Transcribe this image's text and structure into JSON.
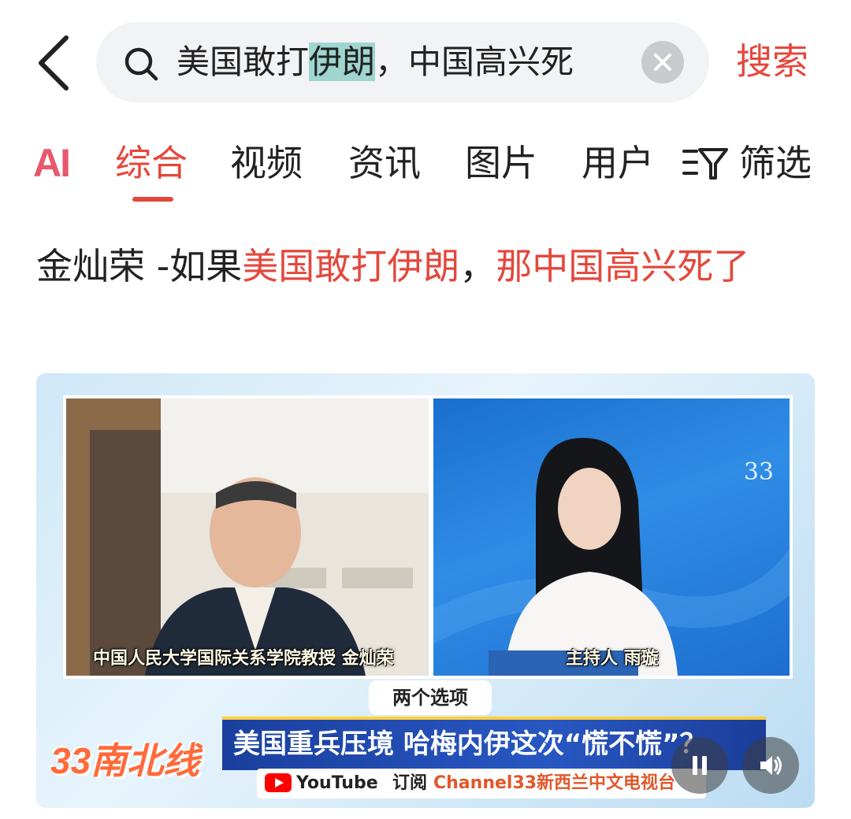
{
  "search": {
    "query_before": "美国敢打",
    "query_highlight": "伊朗",
    "query_after": "，中国高兴死",
    "button_label": "搜索"
  },
  "tabs": {
    "ai_label": "AI",
    "items": [
      {
        "label": "综合",
        "active": true
      },
      {
        "label": "视频",
        "active": false
      },
      {
        "label": "资讯",
        "active": false
      },
      {
        "label": "图片",
        "active": false
      },
      {
        "label": "用户",
        "active": false
      }
    ],
    "filter_label": "筛选"
  },
  "result": {
    "title_plain": "金灿荣 -如果",
    "title_red1": "美国敢打伊朗",
    "title_comma": "，",
    "title_red2": "那中国高兴死了"
  },
  "video": {
    "left_caption": "中国人民大学国际关系学院教授  金灿荣",
    "right_caption": "主持人  雨璇",
    "channel_logo": "33",
    "topic_tag": "两个选项",
    "show_logo": "33南北线",
    "headline": "美国重兵压境 哈梅内伊这次“慌不慌”？",
    "youtube_label": "YouTube",
    "subscribe_label": "订阅",
    "channel_name": "Channel33新西兰中文电视台"
  },
  "colors": {
    "accent": "#e4473c",
    "ai": "#e8576e",
    "highlight": "#9fd6cf",
    "search_bg": "#f2f3f5"
  },
  "icons": [
    "back-arrow-icon",
    "search-icon",
    "clear-icon",
    "filter-icon",
    "pause-icon",
    "volume-icon",
    "youtube-icon"
  ]
}
